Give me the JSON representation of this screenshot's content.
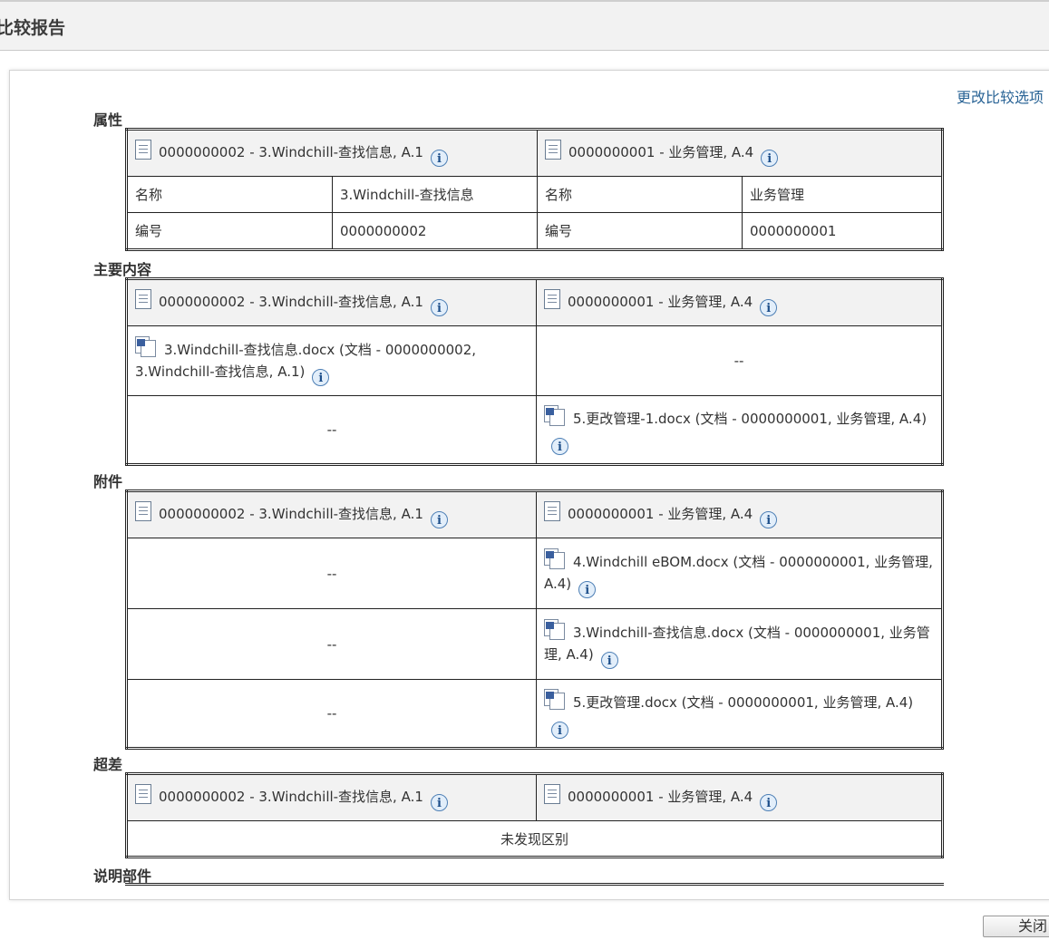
{
  "page_title": "比较报告",
  "change_options_link": "更改比较选项",
  "close_button": "关闭",
  "object_a": {
    "number": "0000000002",
    "name": "3.Windchill-查找信息",
    "title": "0000000002 - 3.Windchill-查找信息, A.1"
  },
  "object_b": {
    "number": "0000000001",
    "name": "业务管理",
    "title": "0000000001 - 业务管理, A.4"
  },
  "dash": "--",
  "sections": {
    "attributes": {
      "label": "属性",
      "rows": [
        {
          "a_label": "名称",
          "a_value": "3.Windchill-查找信息",
          "b_label": "名称",
          "b_value": "业务管理"
        },
        {
          "a_label": "编号",
          "a_value": "0000000002",
          "b_label": "编号",
          "b_value": "0000000001"
        }
      ]
    },
    "primary_content": {
      "label": "主要内容",
      "rows": [
        {
          "a": "3.Windchill-查找信息.docx (文档 - 0000000002, 3.Windchill-查找信息, A.1)",
          "b": "--"
        },
        {
          "a": "--",
          "b": "5.更改管理-1.docx (文档 - 0000000001, 业务管理, A.4)"
        }
      ]
    },
    "attachments": {
      "label": "附件",
      "rows": [
        {
          "a": "--",
          "b": "4.Windchill eBOM.docx (文档 - 0000000001, 业务管理, A.4)"
        },
        {
          "a": "--",
          "b": "3.Windchill-查找信息.docx (文档 - 0000000001, 业务管理, A.4)"
        },
        {
          "a": "--",
          "b": "5.更改管理.docx (文档 - 0000000001, 业务管理, A.4)"
        }
      ]
    },
    "deviations": {
      "label": "超差",
      "no_diff": "未发现区别"
    },
    "described_by": {
      "label": "说明部件"
    }
  },
  "icons": {
    "document": "document-icon",
    "word_file": "word-file-icon",
    "info": "info-icon"
  }
}
